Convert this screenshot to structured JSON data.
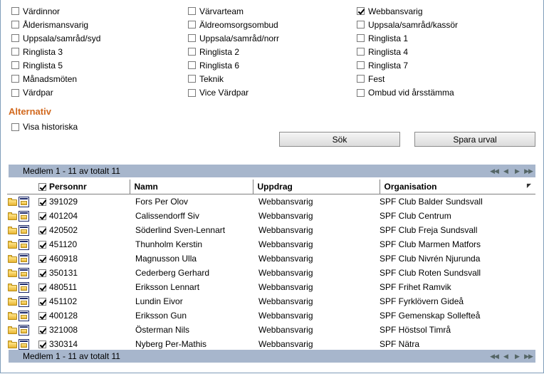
{
  "checkbox_rows": [
    [
      {
        "label": "Värdinnor",
        "checked": false
      },
      {
        "label": "Värvarteam",
        "checked": false
      },
      {
        "label": "Webbansvarig",
        "checked": true
      }
    ],
    [
      {
        "label": "Ålderismansvarig",
        "checked": false
      },
      {
        "label": "Äldreomsorgsombud",
        "checked": false
      },
      {
        "label": "Uppsala/samråd/kassör",
        "checked": false
      }
    ],
    [
      {
        "label": "Uppsala/samråd/syd",
        "checked": false
      },
      {
        "label": "Uppsala/samråd/norr",
        "checked": false
      },
      {
        "label": "Ringlista 1",
        "checked": false
      }
    ],
    [
      {
        "label": "Ringlista 3",
        "checked": false
      },
      {
        "label": "Ringlista 2",
        "checked": false
      },
      {
        "label": "Ringlista 4",
        "checked": false
      }
    ],
    [
      {
        "label": "Ringlista 5",
        "checked": false
      },
      {
        "label": "Ringlista 6",
        "checked": false
      },
      {
        "label": "Ringlista 7",
        "checked": false
      }
    ],
    [
      {
        "label": "Månadsmöten",
        "checked": false
      },
      {
        "label": "Teknik",
        "checked": false
      },
      {
        "label": "Fest",
        "checked": false
      }
    ],
    [
      {
        "label": "Värdpar",
        "checked": false
      },
      {
        "label": "Vice Värdpar",
        "checked": false
      },
      {
        "label": "Ombud vid årsstämma",
        "checked": false
      }
    ]
  ],
  "alternativ": {
    "title": "Alternativ",
    "show_history_label": "Visa historiska",
    "show_history_checked": false
  },
  "buttons": {
    "search": "Sök",
    "save_selection": "Spara urval"
  },
  "pager": {
    "summary": "Medlem 1 - 11 av totalt 11",
    "icons": [
      "first-page-icon",
      "prev-page-icon",
      "next-page-icon",
      "last-page-icon"
    ]
  },
  "table": {
    "headers": {
      "personnr": "Personnr",
      "namn": "Namn",
      "uppdrag": "Uppdrag",
      "organisation": "Organisation"
    },
    "header_checked": true,
    "rows": [
      {
        "personnr": "391029",
        "namn": "Fors Per Olov",
        "uppdrag": "Webbansvarig",
        "organisation": "SPF Club Balder Sundsvall",
        "checked": true
      },
      {
        "personnr": "401204",
        "namn": "Calissendorff Siv",
        "uppdrag": "Webbansvarig",
        "organisation": "SPF Club Centrum",
        "checked": true
      },
      {
        "personnr": "420502",
        "namn": "Söderlind Sven-Lennart",
        "uppdrag": "Webbansvarig",
        "organisation": "SPF Club Freja Sundsvall",
        "checked": true
      },
      {
        "personnr": "451120",
        "namn": "Thunholm Kerstin",
        "uppdrag": "Webbansvarig",
        "organisation": "SPF Club Marmen Matfors",
        "checked": true
      },
      {
        "personnr": "460918",
        "namn": "Magnusson Ulla",
        "uppdrag": "Webbansvarig",
        "organisation": "SPF Club Nivrén Njurunda",
        "checked": true
      },
      {
        "personnr": "350131",
        "namn": "Cederberg Gerhard",
        "uppdrag": "Webbansvarig",
        "organisation": "SPF Club Roten Sundsvall",
        "checked": true
      },
      {
        "personnr": "480511",
        "namn": "Eriksson Lennart",
        "uppdrag": "Webbansvarig",
        "organisation": "SPF Frihet Ramvik",
        "checked": true
      },
      {
        "personnr": "451102",
        "namn": "Lundin Eivor",
        "uppdrag": "Webbansvarig",
        "organisation": "SPF Fyrklövern Gideå",
        "checked": true
      },
      {
        "personnr": "400128",
        "namn": "Eriksson Gun",
        "uppdrag": "Webbansvarig",
        "organisation": "SPF Gemenskap Sollefteå",
        "checked": true
      },
      {
        "personnr": "321008",
        "namn": "Österman Nils",
        "uppdrag": "Webbansvarig",
        "organisation": "SPF Höstsol Timrå",
        "checked": true
      },
      {
        "personnr": "330314",
        "namn": "Nyberg Per-Mathis",
        "uppdrag": "Webbansvarig",
        "organisation": "SPF Nätra",
        "checked": true
      }
    ]
  },
  "colors": {
    "section_title": "#d2691e",
    "pager_bar": "#a7b6cc"
  }
}
